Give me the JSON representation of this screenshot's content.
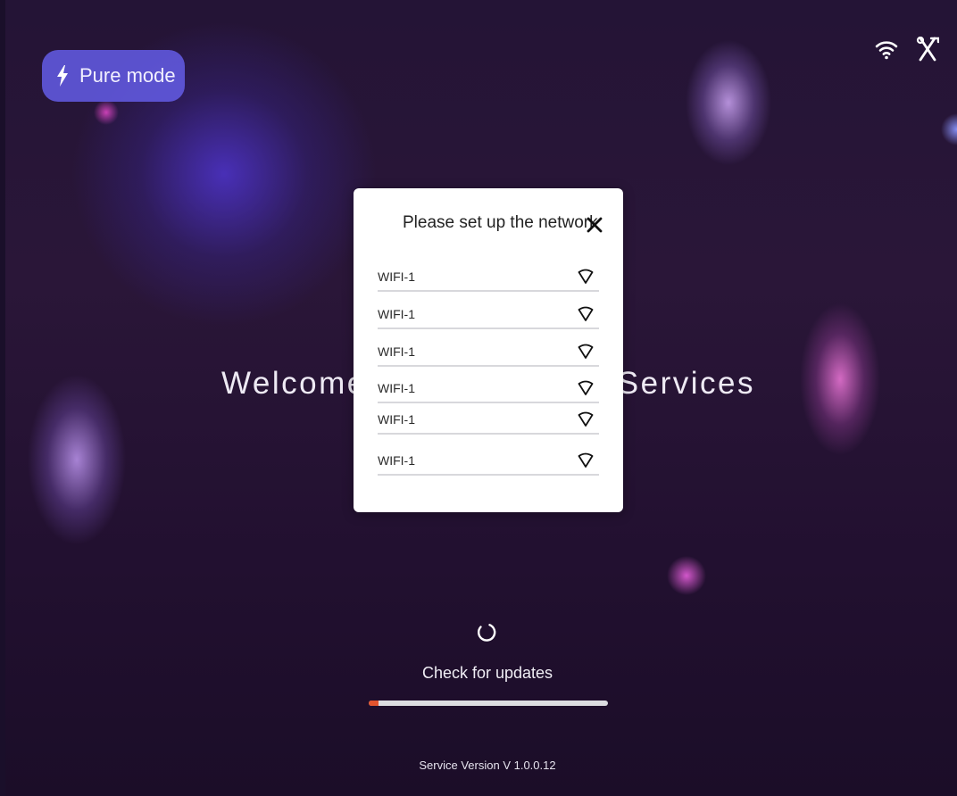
{
  "header": {
    "mode_label": "Pure mode",
    "mode_icon": "lightning-icon",
    "icons": [
      "wifi-icon",
      "tools-icon"
    ]
  },
  "welcome": {
    "left_text": "Welcome",
    "right_text": "Services"
  },
  "network_dialog": {
    "title": "Please set up the network",
    "close_icon": "close-icon",
    "networks": [
      {
        "name": "WIFI-1"
      },
      {
        "name": "WIFI-1"
      },
      {
        "name": "WIFI-1"
      },
      {
        "name": "WIFI-1"
      },
      {
        "name": "WIFI-1"
      },
      {
        "name": "WIFI-1"
      }
    ]
  },
  "update": {
    "label": "Check for updates",
    "progress": 0.04
  },
  "footer": {
    "version": "Service Version V 1.0.0.12"
  },
  "colors": {
    "pill_background": "#625ae1",
    "progress_fill": "#e2542e",
    "progress_track": "#dcdce0"
  }
}
